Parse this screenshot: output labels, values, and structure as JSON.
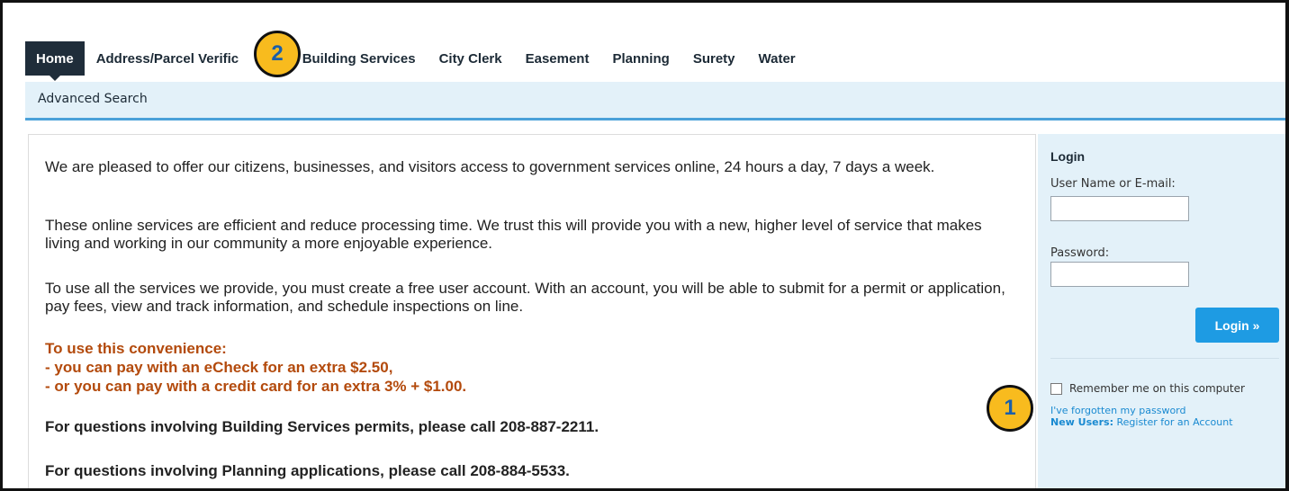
{
  "nav": {
    "tabs": [
      {
        "label": "Home"
      },
      {
        "label": "Address/Parcel Verification"
      },
      {
        "label": "Building Services"
      },
      {
        "label": "City Clerk"
      },
      {
        "label": "Easement"
      },
      {
        "label": "Planning"
      },
      {
        "label": "Surety"
      },
      {
        "label": "Water"
      }
    ]
  },
  "subnav": {
    "items": [
      {
        "label": "Advanced Search"
      }
    ]
  },
  "content": {
    "p1": "We are pleased to offer our citizens, businesses, and visitors access to government services online, 24 hours a day, 7 days a week.",
    "p2": "These online services are efficient and reduce processing time.  We trust this will provide you with a new, higher level of service that makes living and working in our community a more enjoyable experience.",
    "p3": "To use all the services we provide, you must create a free user account. With an account, you will be able to submit for a permit or application, pay fees, view and track information, and schedule inspections on line.",
    "fee_title": "To use this convenience:",
    "fee_line1": "- you can pay with an eCheck for an extra $2.50,",
    "fee_line2": "- or you can pay with a credit card for an extra 3% + $1.00.",
    "building_contact": "For questions involving Building Services permits, please call 208-887-2211.",
    "planning_contact": "For questions involving Planning applications, please call 208-884-5533."
  },
  "login": {
    "title": "Login",
    "username_label": "User Name or E-mail:",
    "username_value": "",
    "password_label": "Password:",
    "password_value": "",
    "button_label": "Login »",
    "remember_label": "Remember me on this computer",
    "remember_checked": false,
    "forgot_link": "I've forgotten my password",
    "new_users_prefix": "New Users:",
    "register_link": "Register for an Account"
  },
  "annotations": {
    "badge1": "1",
    "badge2": "2",
    "badge_color": "#f8bb1e",
    "badge_text_color": "#1b5faa"
  },
  "colors": {
    "nav_active_bg": "#1f2d3a",
    "subnav_bg": "#e3f1f9",
    "accent_blue": "#1e9be3",
    "fee_text": "#b34a0c"
  }
}
